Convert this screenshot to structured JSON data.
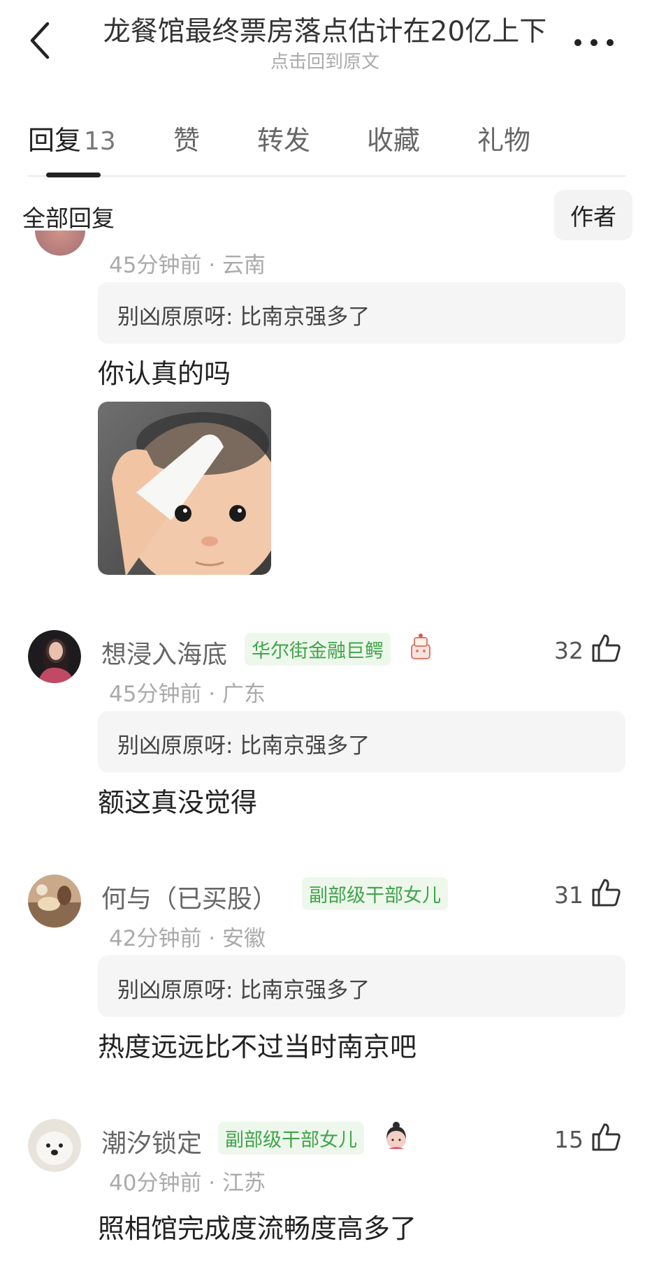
{
  "header": {
    "title": "龙餐馆最终票房落点估计在20亿上下",
    "subtitle": "点击回到原文"
  },
  "tabs": [
    {
      "label": "回复",
      "count": "13"
    },
    {
      "label": "赞"
    },
    {
      "label": "转发"
    },
    {
      "label": "收藏"
    },
    {
      "label": "礼物"
    }
  ],
  "filter": {
    "label": "全部回复",
    "author_button": "作者"
  },
  "comments": [
    {
      "meta": "45分钟前 · 云南",
      "quote": "别凶原原呀: 比南京强多了",
      "content": "你认真的吗"
    },
    {
      "name": "想浸入海底",
      "badge": "华尔街金融巨鳄",
      "meta": "45分钟前 · 广东",
      "quote": "别凶原原呀: 比南京强多了",
      "content": "额这真没觉得",
      "likes": "32"
    },
    {
      "name": "何与（已买股）",
      "badge": "副部级干部女儿",
      "meta": "42分钟前 · 安徽",
      "quote": "别凶原原呀: 比南京强多了",
      "content": "热度远远比不过当时南京吧",
      "likes": "31"
    },
    {
      "name": "潮汐锁定",
      "badge": "副部级干部女儿",
      "meta": "40分钟前 · 江苏",
      "content": "照相馆完成度流畅度高多了",
      "likes": "15"
    }
  ],
  "colors": {
    "badge_green": "#3fa54a",
    "badge_bg": "#eef7ec",
    "quote_bg": "#f5f5f5"
  }
}
